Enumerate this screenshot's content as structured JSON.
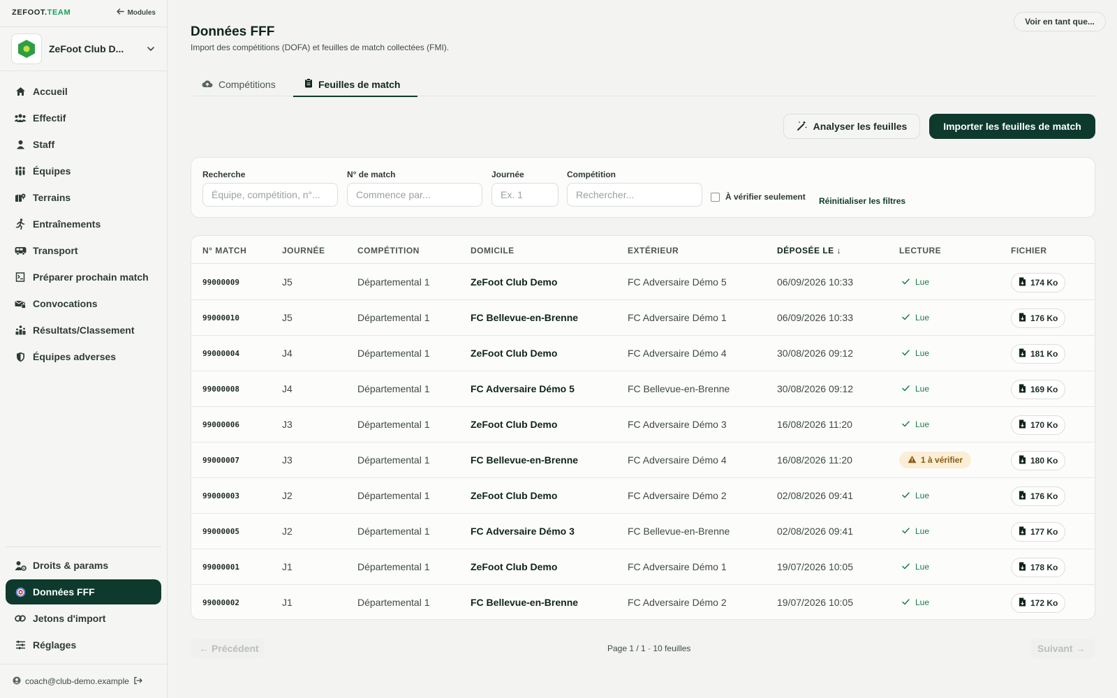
{
  "brand": {
    "name_main": "ZEFOOT.",
    "name_accent": "TEAM",
    "modules_label": "Modules"
  },
  "club": {
    "name": "ZeFoot Club D..."
  },
  "nav": {
    "items": [
      {
        "label": "Accueil",
        "icon": "home-icon"
      },
      {
        "label": "Effectif",
        "icon": "users-icon"
      },
      {
        "label": "Staff",
        "icon": "user-icon"
      },
      {
        "label": "Équipes",
        "icon": "team-icon"
      },
      {
        "label": "Terrains",
        "icon": "map-pin-icon"
      },
      {
        "label": "Entraînements",
        "icon": "running-icon"
      },
      {
        "label": "Transport",
        "icon": "bus-icon"
      },
      {
        "label": "Préparer prochain match",
        "icon": "clipboard-icon"
      },
      {
        "label": "Convocations",
        "icon": "mail-lock-icon"
      },
      {
        "label": "Résultats/Classement",
        "icon": "podium-icon"
      },
      {
        "label": "Équipes adverses",
        "icon": "shield-icon"
      }
    ],
    "bottom_items": [
      {
        "label": "Droits & params",
        "icon": "user-cog-icon"
      },
      {
        "label": "Données FFF",
        "icon": "database-icon",
        "active": true
      },
      {
        "label": "Jetons d'import",
        "icon": "link-icon"
      },
      {
        "label": "Réglages",
        "icon": "sliders-icon"
      }
    ]
  },
  "user": {
    "email": "coach@club-demo.example"
  },
  "header": {
    "view_as": "Voir en tant que...",
    "title": "Données FFF",
    "subtitle": "Import des compétitions (DOFA) et feuilles de match collectées (FMI)."
  },
  "tabs": [
    {
      "label": "Compétitions"
    },
    {
      "label": "Feuilles de match",
      "active": true
    }
  ],
  "actions": {
    "analyze": "Analyser les feuilles",
    "import": "Importer les feuilles de match"
  },
  "filters": {
    "search": {
      "label": "Recherche",
      "placeholder": "Équipe, compétition, n°..."
    },
    "match_no": {
      "label": "N° de match",
      "placeholder": "Commence par..."
    },
    "round": {
      "label": "Journée",
      "placeholder": "Ex. 1"
    },
    "competition": {
      "label": "Compétition",
      "placeholder": "Rechercher..."
    },
    "verify_only": "À vérifier seulement",
    "reset": "Réinitialiser les filtres"
  },
  "table": {
    "headers": [
      "N° MATCH",
      "JOURNÉE",
      "COMPÉTITION",
      "DOMICILE",
      "EXTÉRIEUR",
      "DÉPOSÉE LE",
      "LECTURE",
      "FICHIER"
    ],
    "sort_indicator": "↓",
    "rows": [
      {
        "match": "99000009",
        "round": "J5",
        "competition": "Départemental 1",
        "home": "ZeFoot Club Demo",
        "away": "FC Adversaire Démo 5",
        "date": "06/09/2026 10:33",
        "status": "Lue",
        "status_type": "ok",
        "file": "174 Ko"
      },
      {
        "match": "99000010",
        "round": "J5",
        "competition": "Départemental 1",
        "home": "FC Bellevue-en-Brenne",
        "away": "FC Adversaire Démo 1",
        "date": "06/09/2026 10:33",
        "status": "Lue",
        "status_type": "ok",
        "file": "176 Ko"
      },
      {
        "match": "99000004",
        "round": "J4",
        "competition": "Départemental 1",
        "home": "ZeFoot Club Demo",
        "away": "FC Adversaire Démo 4",
        "date": "30/08/2026 09:12",
        "status": "Lue",
        "status_type": "ok",
        "file": "181 Ko"
      },
      {
        "match": "99000008",
        "round": "J4",
        "competition": "Départemental 1",
        "home": "FC Adversaire Démo 5",
        "away": "FC Bellevue-en-Brenne",
        "date": "30/08/2026 09:12",
        "status": "Lue",
        "status_type": "ok",
        "file": "169 Ko"
      },
      {
        "match": "99000006",
        "round": "J3",
        "competition": "Départemental 1",
        "home": "ZeFoot Club Demo",
        "away": "FC Adversaire Démo 3",
        "date": "16/08/2026 11:20",
        "status": "Lue",
        "status_type": "ok",
        "file": "170 Ko"
      },
      {
        "match": "99000007",
        "round": "J3",
        "competition": "Départemental 1",
        "home": "FC Bellevue-en-Brenne",
        "away": "FC Adversaire Démo 4",
        "date": "16/08/2026 11:20",
        "status": "1 à vérifier",
        "status_type": "warn",
        "file": "180 Ko"
      },
      {
        "match": "99000003",
        "round": "J2",
        "competition": "Départemental 1",
        "home": "ZeFoot Club Demo",
        "away": "FC Adversaire Démo 2",
        "date": "02/08/2026 09:41",
        "status": "Lue",
        "status_type": "ok",
        "file": "176 Ko"
      },
      {
        "match": "99000005",
        "round": "J2",
        "competition": "Départemental 1",
        "home": "FC Adversaire Démo 3",
        "away": "FC Bellevue-en-Brenne",
        "date": "02/08/2026 09:41",
        "status": "Lue",
        "status_type": "ok",
        "file": "177 Ko"
      },
      {
        "match": "99000001",
        "round": "J1",
        "competition": "Départemental 1",
        "home": "ZeFoot Club Demo",
        "away": "FC Adversaire Démo 1",
        "date": "19/07/2026 10:05",
        "status": "Lue",
        "status_type": "ok",
        "file": "178 Ko"
      },
      {
        "match": "99000002",
        "round": "J1",
        "competition": "Départemental 1",
        "home": "FC Bellevue-en-Brenne",
        "away": "FC Adversaire Démo 2",
        "date": "19/07/2026 10:05",
        "status": "Lue",
        "status_type": "ok",
        "file": "172 Ko"
      }
    ]
  },
  "pagination": {
    "prev": "Précédent",
    "info": "Page 1 / 1 · 10 feuilles",
    "next": "Suivant"
  },
  "colors": {
    "brand_dark": "#0e3a2d",
    "accent": "#1a9d5e",
    "ok": "#1a7a4c",
    "warn_bg": "#fbeed6"
  }
}
